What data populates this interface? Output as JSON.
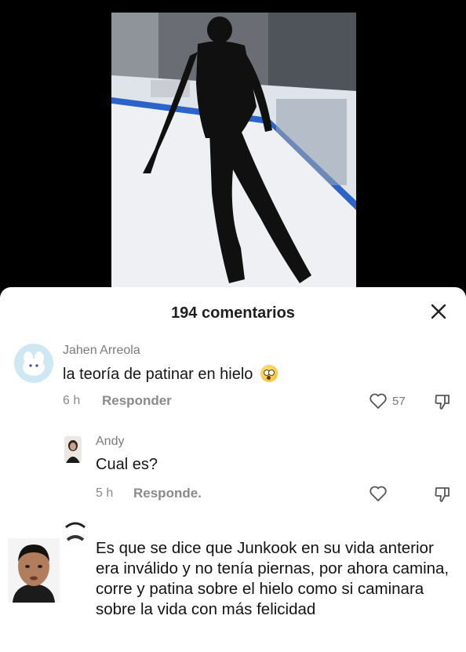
{
  "comments_sheet": {
    "title": "194 comentarios",
    "close_label": "✕"
  },
  "comments": [
    {
      "author": "Jahen Arreola",
      "text": "la teoría de patinar en hielo",
      "emoji": "flushed-face-emoji",
      "time": "6 h",
      "reply_label": "Responder",
      "likes": "57"
    },
    {
      "author": "Andy",
      "text": "Cual es?",
      "time": "5 h",
      "reply_label": "Responde."
    }
  ],
  "reply_overlay": {
    "text": "Es que se dice que Junkook en su vida anterior era inválido y no tenía piernas, por ahora camina, corre y patina sobre el hielo como si caminara sobre la vida con más felicidad"
  },
  "colors": {
    "sheet_bg": "#ffffff",
    "text_primary": "#161616",
    "text_secondary": "#8a8a8a",
    "rink_border": "#2b63c9"
  },
  "icons": [
    "close-icon",
    "heart-icon",
    "dislike-icon"
  ]
}
